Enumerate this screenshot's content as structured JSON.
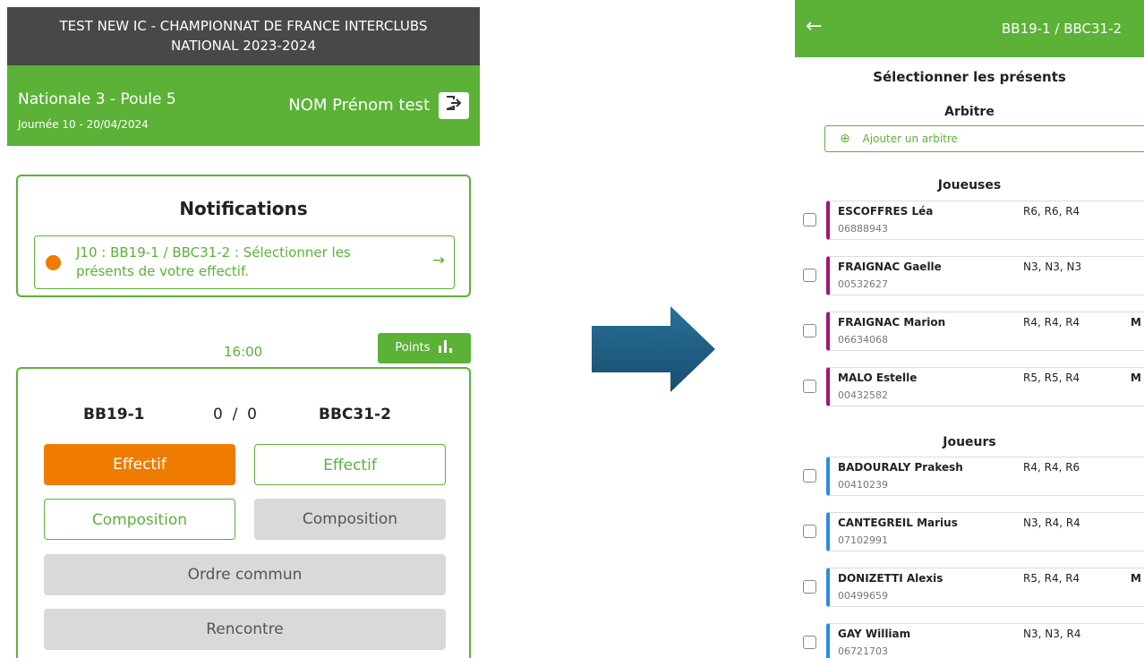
{
  "left": {
    "title_line1": "TEST NEW IC - CHAMPIONNAT DE FRANCE INTERCLUBS",
    "title_line2": "NATIONAL 2023-2024",
    "division": "Nationale 3 - Poule 5",
    "journee": "Journée 10 - 20/04/2024",
    "user": "NOM Prénom test",
    "logout_icon": "logout-icon",
    "notifications_title": "Notifications",
    "notification_line1": "J10 : BB19-1 / BBC31-2 : Sélectionner les",
    "notification_line2": "présents de votre effectif.",
    "notification_arrow": "→",
    "time": "16:00",
    "points_label": "Points",
    "points_icon": "bar-chart-icon",
    "team_home": "BB19-1",
    "score": "0  /  0",
    "team_away": "BBC31-2",
    "btn_effectif_home": "Effectif",
    "btn_effectif_away": "Effectif",
    "btn_composition_home": "Composition",
    "btn_composition_away": "Composition",
    "btn_ordre": "Ordre commun",
    "btn_rencontre": "Rencontre",
    "colors": {
      "green": "#5bb237",
      "orange": "#ef7c00",
      "dark": "#484848",
      "arrow": "#1f5f86"
    }
  },
  "right": {
    "back": "←",
    "title": "BB19-1 / BBC31-2",
    "heading": "Sélectionner les présents",
    "arbitre_heading": "Arbitre",
    "add_arbitre": "Ajouter un arbitre",
    "joueuses_heading": "Joueuses",
    "joueurs_heading": "Joueurs",
    "joueuses": [
      {
        "name": "ESCOFFRES Léa",
        "license": "06888943",
        "ranks": "R6, R6, R4",
        "flag": ""
      },
      {
        "name": "FRAIGNAC Gaelle",
        "license": "00532627",
        "ranks": "N3, N3, N3",
        "flag": ""
      },
      {
        "name": "FRAIGNAC Marion",
        "license": "06634068",
        "ranks": "R4, R4, R4",
        "flag": "M"
      },
      {
        "name": "MALO Estelle",
        "license": "00432582",
        "ranks": "R5, R5, R4",
        "flag": "M"
      }
    ],
    "joueurs": [
      {
        "name": "BADOURALY Prakesh",
        "license": "00410239",
        "ranks": "R4, R4, R6",
        "flag": ""
      },
      {
        "name": "CANTEGREIL Marius",
        "license": "07102991",
        "ranks": "N3, R4, R4",
        "flag": ""
      },
      {
        "name": "DONIZETTI Alexis",
        "license": "00499659",
        "ranks": "R5, R4, R4",
        "flag": "M"
      },
      {
        "name": "GAY William",
        "license": "06721703",
        "ranks": "N3, N3, R4",
        "flag": ""
      }
    ],
    "colors": {
      "female": "#a0157a",
      "male": "#2d8be0"
    }
  }
}
